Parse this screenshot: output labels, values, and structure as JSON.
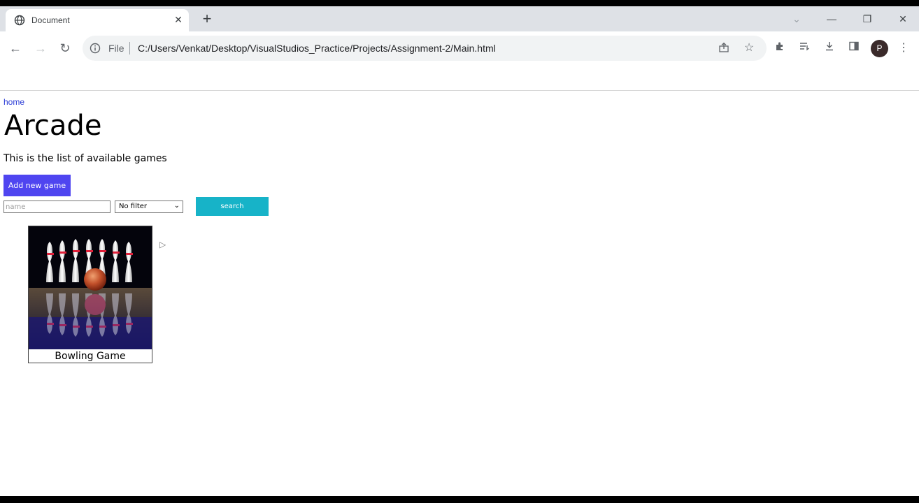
{
  "browser": {
    "tab_title": "Document",
    "tab_close": "✕",
    "new_tab": "+",
    "scheme": "File",
    "url": "C:/Users/Venkat/Desktop/VisualStudios_Practice/Projects/Assignment-2/Main.html",
    "profile_initial": "P",
    "window_controls": {
      "dropdown": "⌄",
      "minimize": "—",
      "restore": "❐",
      "close": "✕"
    },
    "nav": {
      "back": "←",
      "forward": "→",
      "reload": "↻"
    },
    "icons": [
      "share-icon",
      "star-icon",
      "extensions-icon",
      "reading-list-icon",
      "download-icon",
      "side-panel-icon",
      "menu-icon"
    ]
  },
  "page": {
    "home_link": "home",
    "title": "Arcade",
    "subtitle": "This is the list of available games",
    "add_button": "Add new game",
    "search_placeholder": "name",
    "filter_value": "No filter",
    "search_button": "search",
    "games": [
      {
        "name": "Bowling Game"
      }
    ]
  },
  "colors": {
    "add_button": "#4f45f0",
    "search_button": "#17b3c8",
    "link": "#2a3bd6"
  }
}
